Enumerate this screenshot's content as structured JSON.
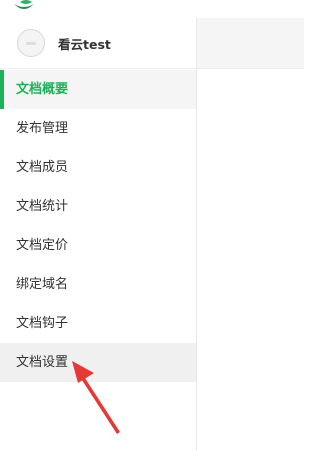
{
  "user": {
    "name": "看云test"
  },
  "nav": {
    "items": [
      {
        "label": "文档概要"
      },
      {
        "label": "发布管理"
      },
      {
        "label": "文档成员"
      },
      {
        "label": "文档统计"
      },
      {
        "label": "文档定价"
      },
      {
        "label": "绑定域名"
      },
      {
        "label": "文档钩子"
      },
      {
        "label": "文档设置"
      }
    ],
    "active_index": 0,
    "hovered_index": 7
  },
  "colors": {
    "accent": "#1bb25a",
    "annotation_arrow": "#e53935"
  }
}
